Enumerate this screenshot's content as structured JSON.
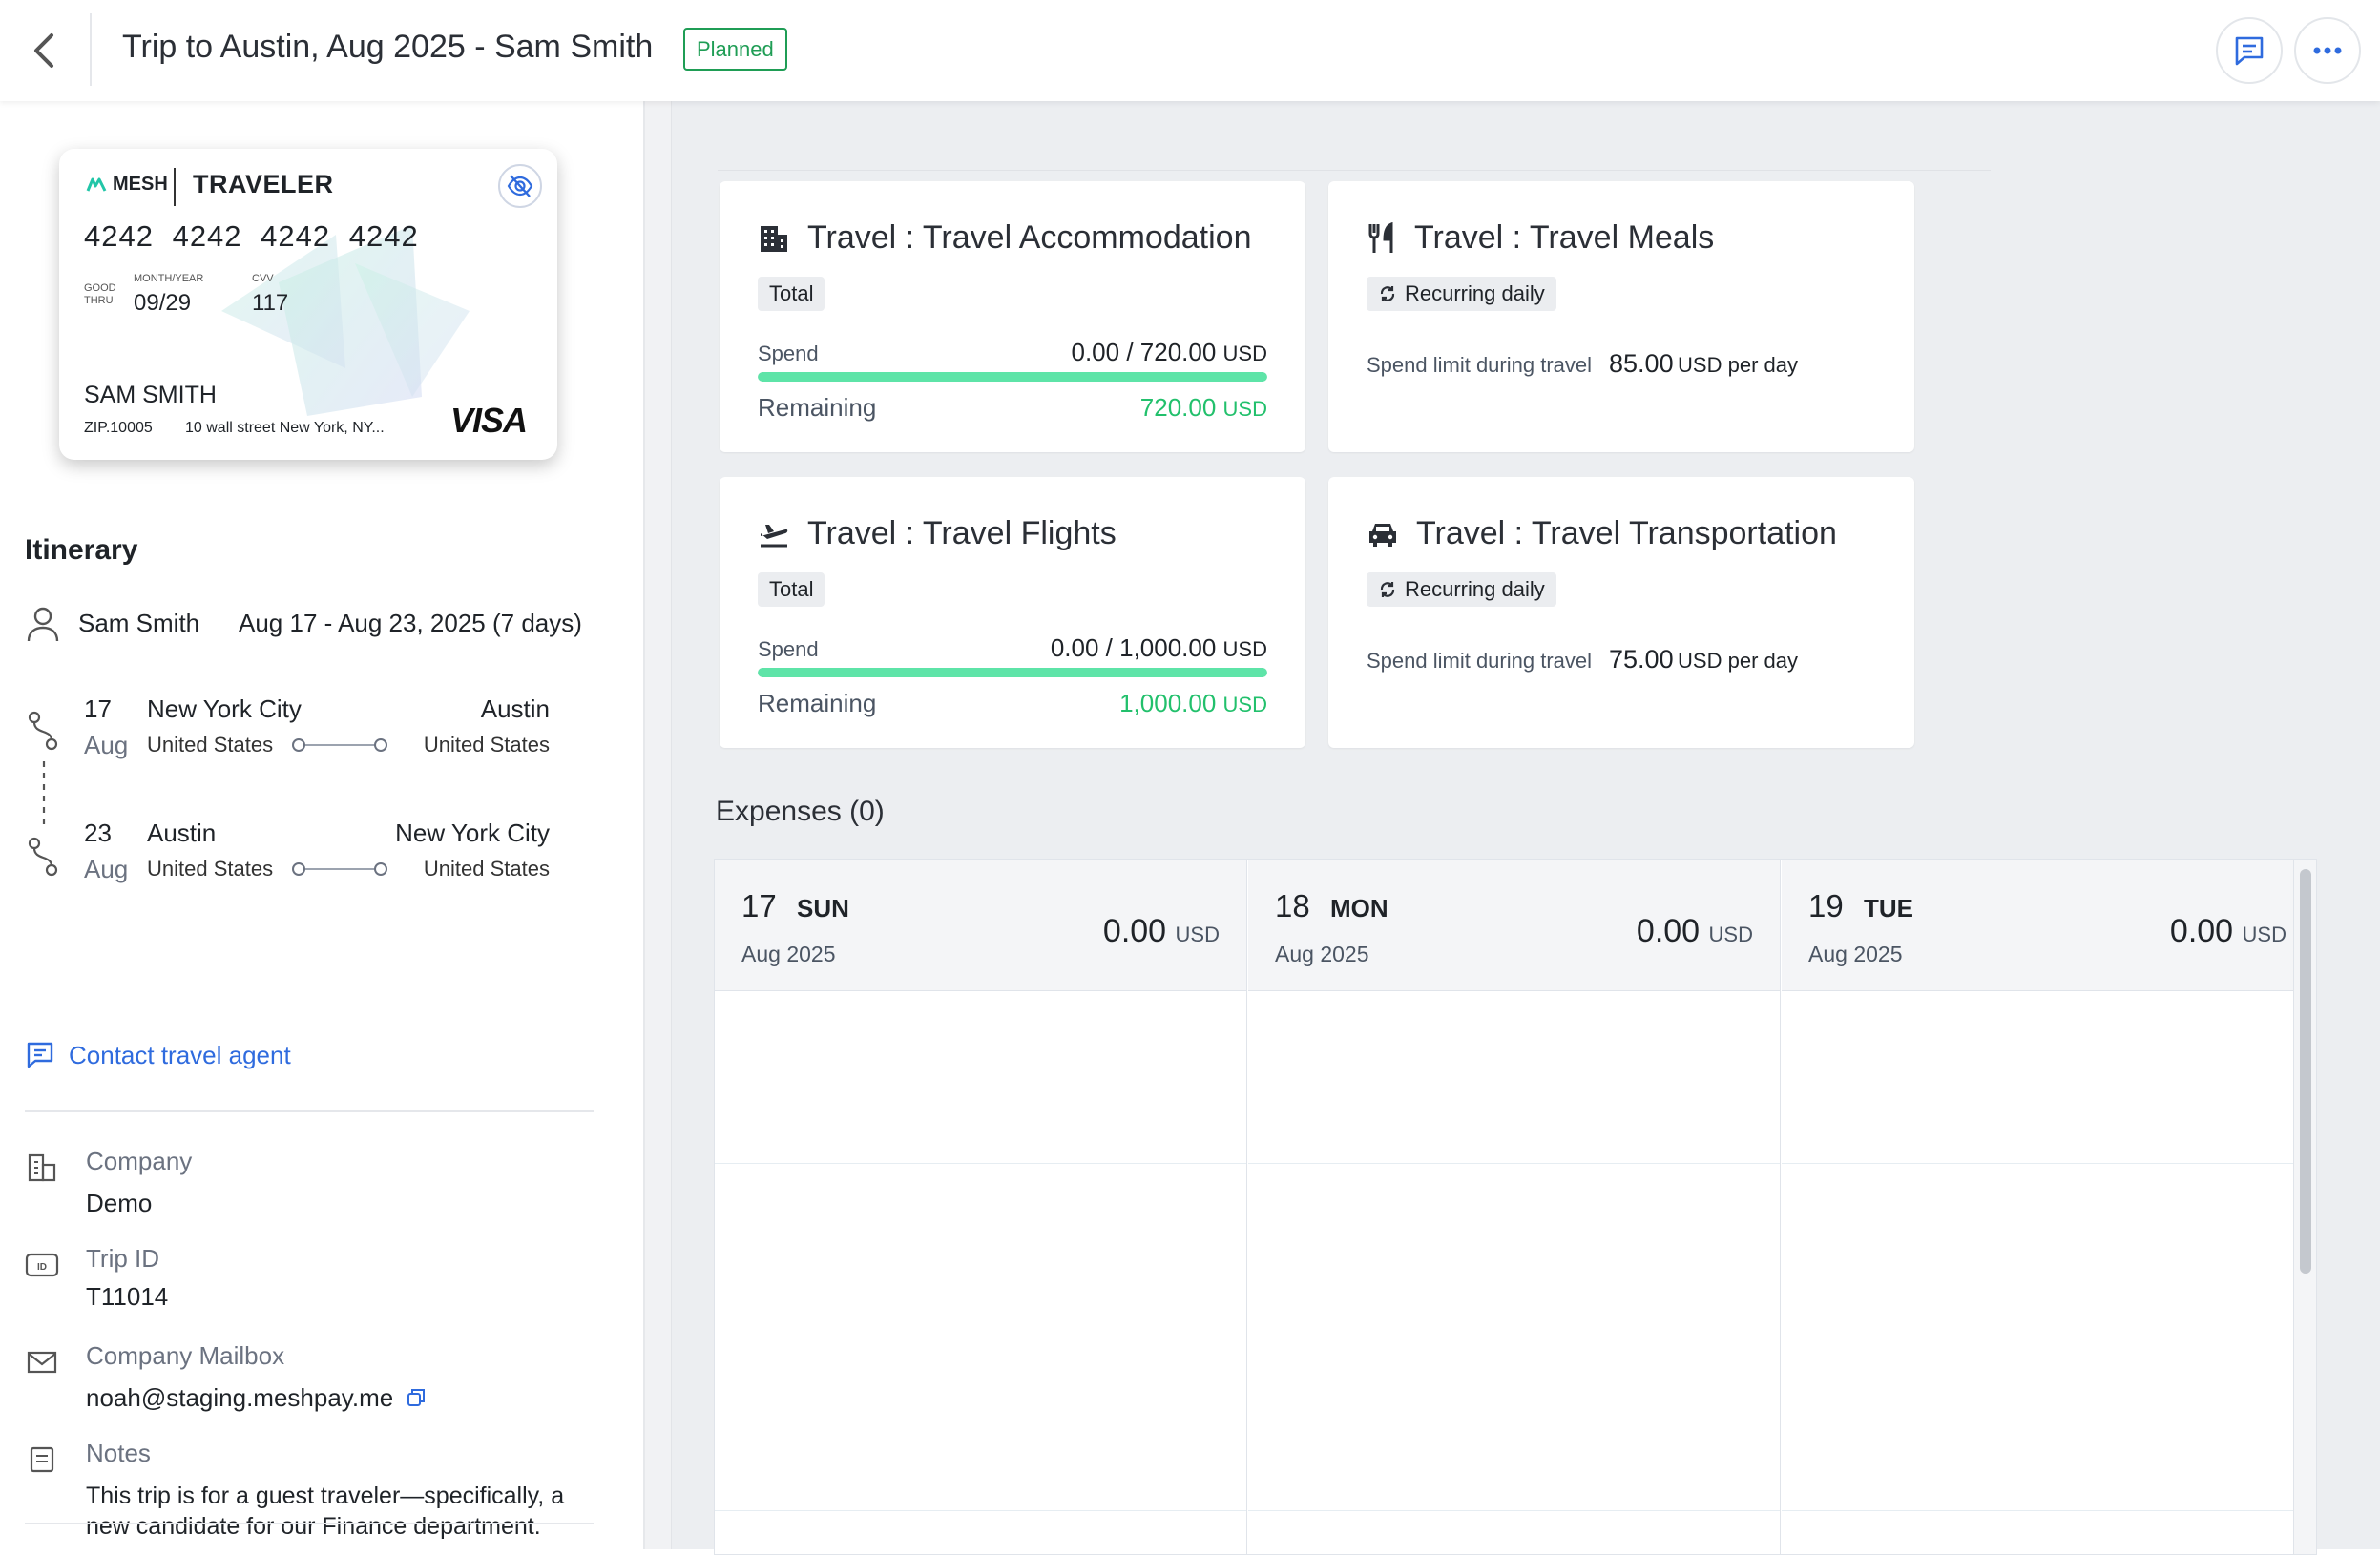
{
  "header": {
    "title": "Trip to Austin, Aug 2025 - Sam Smith",
    "status": "Planned"
  },
  "card": {
    "brand": "MESH",
    "type": "TRAVELER",
    "number": "4242 4242 4242 4242",
    "good_thru_label": "GOOD THRU",
    "month_year_label": "MONTH/YEAR",
    "expiry": "09/29",
    "cvv_label": "CVV",
    "cvv": "117",
    "holder": "SAM SMITH",
    "zip": "ZIP.10005",
    "address": "10 wall street New York, NY...",
    "network": "VISA"
  },
  "itinerary": {
    "title": "Itinerary",
    "traveler": "Sam Smith",
    "dates": "Aug 17 - Aug 23, 2025 (7 days)",
    "legs": [
      {
        "day": "17",
        "month": "Aug",
        "from": "New York City",
        "from_country": "United States",
        "to": "Austin",
        "to_country": "United States"
      },
      {
        "day": "23",
        "month": "Aug",
        "from": "Austin",
        "from_country": "United States",
        "to": "New York City",
        "to_country": "United States"
      }
    ],
    "contact_agent": "Contact travel agent"
  },
  "details": {
    "company_label": "Company",
    "company": "Demo",
    "trip_id_label": "Trip ID",
    "trip_id": "T11014",
    "mailbox_label": "Company Mailbox",
    "mailbox": "noah@staging.meshpay.me",
    "notes_label": "Notes",
    "notes": "This trip is for a guest traveler—specifically, a new candidate for our Finance department."
  },
  "budgets": [
    {
      "title": "Travel : Travel Accommodation",
      "tag": "Total",
      "spend_label": "Spend",
      "spend": "0.00 / 720.00",
      "unit": "USD",
      "remaining_label": "Remaining",
      "remaining": "720.00",
      "spent_fraction": 0
    },
    {
      "title": "Travel : Travel Meals",
      "tag": "Recurring daily",
      "limit_label": "Spend limit during travel",
      "limit": "85.00",
      "limit_unit": "USD per day"
    },
    {
      "title": "Travel : Travel Flights",
      "tag": "Total",
      "spend_label": "Spend",
      "spend": "0.00 / 1,000.00",
      "unit": "USD",
      "remaining_label": "Remaining",
      "remaining": "1,000.00",
      "spent_fraction": 0
    },
    {
      "title": "Travel : Travel Transportation",
      "tag": "Recurring daily",
      "limit_label": "Spend limit during travel",
      "limit": "75.00",
      "limit_unit": "USD per day"
    }
  ],
  "expenses": {
    "title": "Expenses (0)",
    "days": [
      {
        "day": "17",
        "dow": "SUN",
        "month": "Aug 2025",
        "amount": "0.00",
        "unit": "USD"
      },
      {
        "day": "18",
        "dow": "MON",
        "month": "Aug 2025",
        "amount": "0.00",
        "unit": "USD"
      },
      {
        "day": "19",
        "dow": "TUE",
        "month": "Aug 2025",
        "amount": "0.00",
        "unit": "USD"
      }
    ]
  },
  "colors": {
    "accent": "#2f6bde",
    "status_green": "#1f9d55",
    "remaining_green": "#22c06c",
    "bar_fill": "#5ee4a8"
  }
}
